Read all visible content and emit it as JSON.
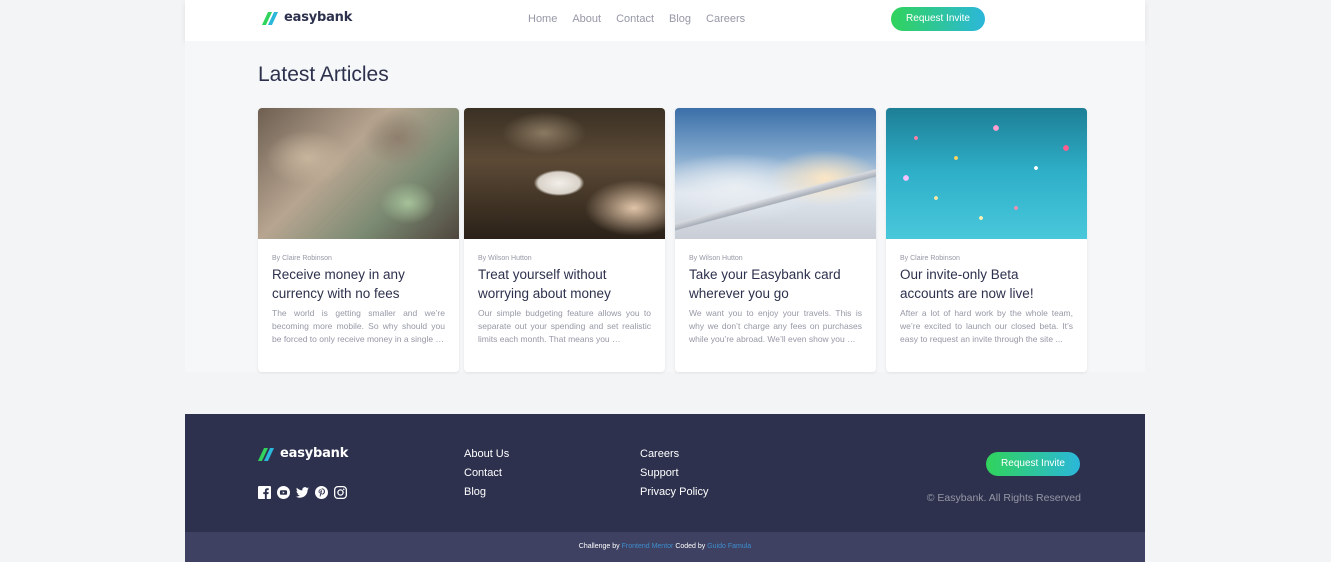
{
  "header": {
    "logo_text": "easybank",
    "nav": [
      "Home",
      "About",
      "Contact",
      "Blog",
      "Careers"
    ],
    "cta": "Request Invite"
  },
  "articles": {
    "title": "Latest Articles",
    "items": [
      {
        "author": "By Claire Robinson",
        "title": "Receive money in any currency with no fees",
        "excerpt": "The world is getting smaller and we’re becoming more mobile. So why should you be forced to only receive money in a single …"
      },
      {
        "author": "By Wilson Hutton",
        "title": "Treat yourself without worrying about money",
        "excerpt": "Our simple budgeting feature allows you to separate out your spending and set realistic limits each month. That means you …"
      },
      {
        "author": "By Wilson Hutton",
        "title": "Take your Easybank card wherever you go",
        "excerpt": "We want you to enjoy your travels. This is why we don’t charge any fees on purchases while you’re abroad. We’ll even show you …"
      },
      {
        "author": "By Claire Robinson",
        "title": "Our invite-only Beta accounts are now live!",
        "excerpt": "After a lot of hard work by the whole team, we’re excited to launch our closed beta. It’s easy to request an invite through the site ..."
      }
    ]
  },
  "footer": {
    "logo_text": "easybank",
    "socials": [
      "facebook-icon",
      "youtube-icon",
      "twitter-icon",
      "pinterest-icon",
      "instagram-icon"
    ],
    "col1": [
      "About Us",
      "Contact",
      "Blog"
    ],
    "col2": [
      "Careers",
      "Support",
      "Privacy Policy"
    ],
    "cta": "Request Invite",
    "copyright": "© Easybank. All Rights Reserved"
  },
  "attribution": {
    "prefix": "Challenge by",
    "challenge_link": "Frontend Mentor",
    "middle": "Coded by",
    "author_link": "Guido Famula"
  },
  "colors": {
    "dark_blue": "#2d314d",
    "lime_green": "#31d35c",
    "bright_cyan": "#2bb7da",
    "grayish_blue": "#9698a6"
  }
}
